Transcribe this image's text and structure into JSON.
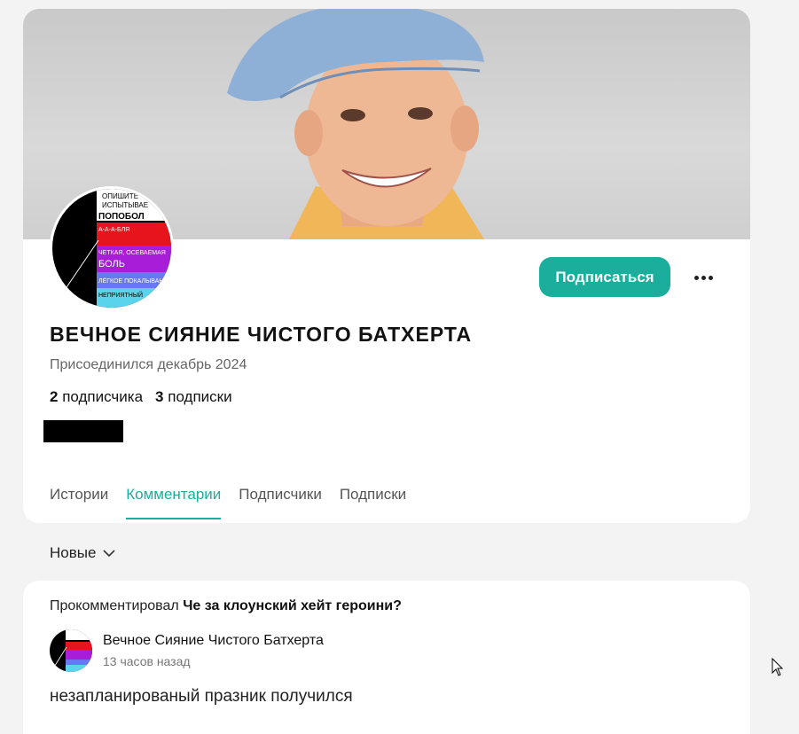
{
  "profile": {
    "name": "ВЕЧНОЕ СИЯНИЕ ЧИСТОГО БАТХЕРТА",
    "joined": "Присоединился декабрь 2024",
    "followers_count": "2",
    "followers_label": "подписчика",
    "following_count": "3",
    "following_label": "подписки",
    "subscribe_label": "Подписаться"
  },
  "avatar_text": {
    "line1": "ОПИШИТЕ",
    "line2": "ИСПЫТЫВАЕ",
    "line3": "ПОПОБОЛ",
    "line4": "А-А-А-БЛЯ",
    "line5": "ЧЕТКАЯ, ОСЕВАЕМАЯ",
    "line6": "БОЛЬ",
    "line7": "ЛЁГКОЕ ПОКАЛЫВАНИЕ",
    "line8": "НЕПРИЯТНЫЙ"
  },
  "tabs": [
    "Истории",
    "Комментарии",
    "Подписчики",
    "Подписки"
  ],
  "sort": {
    "label": "Новые"
  },
  "comment": {
    "prefix": "Прокомментировал",
    "post_title": "Че за клоунский хейт героини?",
    "author": "Вечное Сияние Чистого Батхерта",
    "time": "13 часов назад",
    "text": "незапланированый празник получился"
  },
  "colors": {
    "accent": "#1bae9c"
  },
  "icons": {
    "more": "more-dots-icon",
    "sort": "chevron-down-icon"
  }
}
